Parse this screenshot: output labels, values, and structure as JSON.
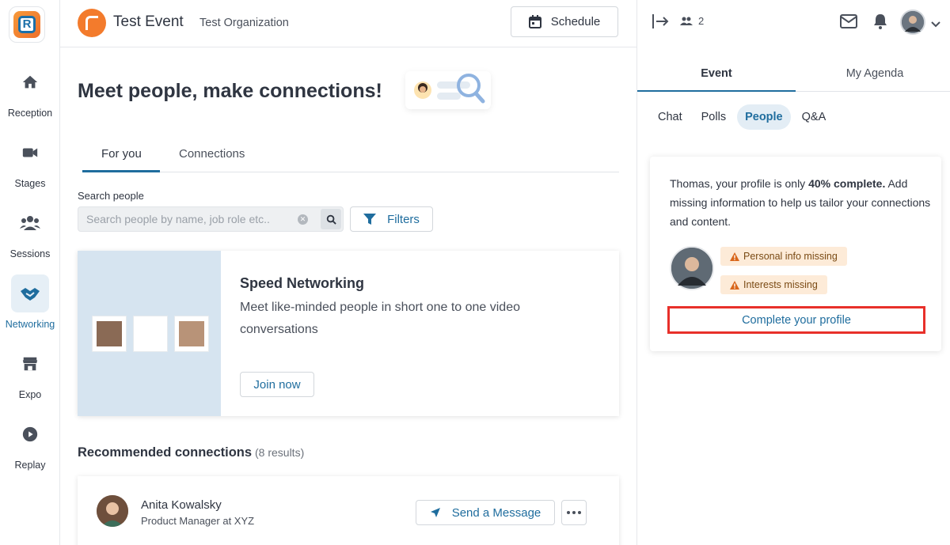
{
  "leftnav": {
    "items": [
      {
        "label": "Reception",
        "icon": "home-icon"
      },
      {
        "label": "Stages",
        "icon": "video-camera-icon"
      },
      {
        "label": "Sessions",
        "icon": "group-icon"
      },
      {
        "label": "Networking",
        "icon": "handshake-icon",
        "active": true
      },
      {
        "label": "Expo",
        "icon": "storefront-icon"
      },
      {
        "label": "Replay",
        "icon": "play-circle-icon"
      }
    ]
  },
  "header": {
    "event_title": "Test Event",
    "org_name": "Test Organization",
    "schedule_label": "Schedule"
  },
  "main": {
    "headline": "Meet people, make connections!",
    "tabs": [
      {
        "label": "For you",
        "active": true
      },
      {
        "label": "Connections",
        "active": false
      }
    ],
    "search": {
      "label": "Search people",
      "placeholder": "Search people by name, job role etc..",
      "value": ""
    },
    "filters_label": "Filters",
    "speed_networking": {
      "title": "Speed Networking",
      "description": "Meet like-minded people in short one to one video conversations",
      "join_label": "Join now"
    },
    "recommended": {
      "title": "Recommended connections",
      "count": "(8 results)",
      "people": [
        {
          "name": "Anita Kowalsky",
          "role": "Product Manager at XYZ",
          "message_label": "Send a Message"
        }
      ]
    }
  },
  "rightpanel": {
    "attendee_count": "2",
    "tabs": [
      {
        "label": "Event",
        "active": true
      },
      {
        "label": "My Agenda",
        "active": false
      }
    ],
    "subtabs": [
      {
        "label": "Chat",
        "active": false
      },
      {
        "label": "Polls",
        "active": false
      },
      {
        "label": "People",
        "active": true
      },
      {
        "label": "Q&A",
        "active": false
      }
    ],
    "profile_card": {
      "msg_prefix": "Thomas, your profile is only ",
      "msg_bold": "40% complete.",
      "msg_suffix": " Add missing information to help us tailor your connections and content.",
      "badges": [
        "Personal info missing",
        "Interests missing"
      ],
      "complete_label": "Complete your profile"
    }
  },
  "colors": {
    "accent": "#1f6d9e",
    "brand_orange": "#f37b2c",
    "warning_bg": "#fdebd8",
    "warning_icon": "#d9661a",
    "highlight_box": "#e8302a"
  }
}
